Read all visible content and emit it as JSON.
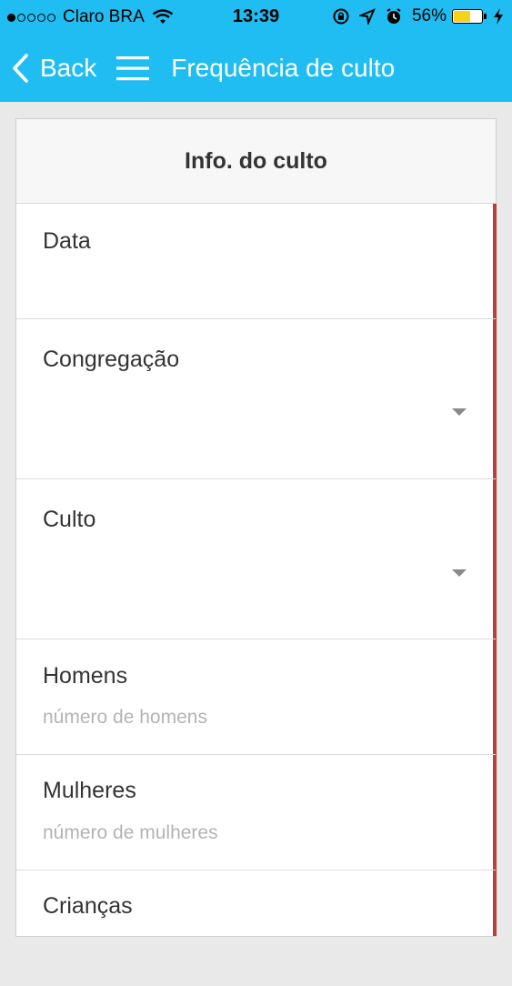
{
  "status_bar": {
    "carrier": "Claro BRA",
    "time": "13:39",
    "battery": "56%",
    "battery_level": 0.56,
    "icons": [
      "signal-dots-icon",
      "wifi-icon",
      "orientation-lock-icon",
      "location-icon",
      "alarm-icon",
      "battery-icon",
      "charging-icon"
    ]
  },
  "nav": {
    "back_label": "Back",
    "title": "Frequência de culto",
    "menu_icon": "hamburger-menu-icon",
    "back_icon": "chevron-left-icon"
  },
  "form": {
    "header": "Info. do culto",
    "fields": [
      {
        "label": "Data",
        "placeholder": "",
        "type": "date"
      },
      {
        "label": "Congregação",
        "placeholder": "",
        "type": "select"
      },
      {
        "label": "Culto",
        "placeholder": "",
        "type": "select"
      },
      {
        "label": "Homens",
        "placeholder": "número de homens",
        "type": "number"
      },
      {
        "label": "Mulheres",
        "placeholder": "número de mulheres",
        "type": "number"
      },
      {
        "label": "Crianças",
        "placeholder": "",
        "type": "number"
      }
    ]
  },
  "colors": {
    "nav_bg": "#1fbdf1",
    "accent_red": "#b9413a",
    "battery_yellow": "#f6d21a"
  }
}
